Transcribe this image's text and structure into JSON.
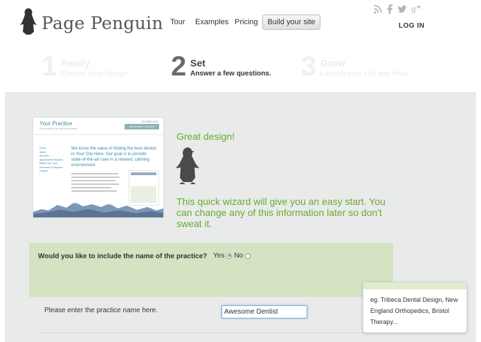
{
  "header": {
    "logo_text": "Page Penguin",
    "nav": {
      "tour": "Tour",
      "examples": "Examples",
      "pricing": "Pricing"
    },
    "build_button": "Build your site",
    "login": "LOG IN",
    "social_icons": [
      "rss-icon",
      "facebook-icon",
      "twitter-icon",
      "google-plus-icon"
    ]
  },
  "steps": [
    {
      "number": "1",
      "title": "Ready",
      "subtitle": "Choose your design",
      "state": "faded"
    },
    {
      "number": "2",
      "title": "Set",
      "subtitle": "Answer a few questions.",
      "state": "active"
    },
    {
      "number": "3",
      "title": "Grow",
      "subtitle": "Launch your site and relax",
      "state": "faded"
    }
  ],
  "preview": {
    "site_name": "Your Practice",
    "tagline": "Good dentistry for the whole family",
    "phone": "212-555-1212",
    "appointment": "APPOINTMENT REQUEST",
    "nav_items": [
      "Home",
      "About",
      "Services",
      "Appointment Request",
      "Before Your Visit",
      "Insurance & Payment",
      "Contact"
    ],
    "headline": "We know the value of finding the best dentist in Your City Here. Our goal is to provide state-of-the-art care in a relaxed, calming environment."
  },
  "intro": {
    "great_design": "Great design!",
    "wizard_text": "This quick wizard will give you an easy start. You can change any of this information later so don't sweat it."
  },
  "question": {
    "label": "Would you like to include the name of the practice?",
    "options": [
      {
        "label": "Yes",
        "checked": true
      },
      {
        "label": "No",
        "checked": false
      }
    ]
  },
  "practice_name": {
    "label": "Please enter the practice name here.",
    "value": "Awesome Dentist"
  },
  "tooltip": {
    "text": "eg. Tribeca Dental Design, New England Orthopedics, Bristol Therapy..."
  },
  "colors": {
    "accent_green": "#6aa832",
    "panel_bg": "#e9ebea",
    "question_bg": "#d4e3c2",
    "preview_teal": "#3a8ba0"
  }
}
